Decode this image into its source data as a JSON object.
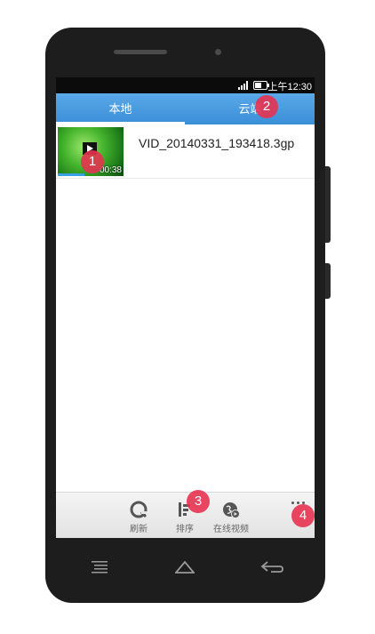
{
  "status_bar": {
    "time": "上午12:30"
  },
  "tabs": [
    {
      "label": "本地",
      "selected": true
    },
    {
      "label": "云端",
      "selected": false
    }
  ],
  "videos": [
    {
      "name": "VID_20140331_193418.3gp",
      "duration": "00:38"
    }
  ],
  "bottom_toolbar": {
    "refresh_label": "刷新",
    "sort_label": "排序",
    "online_label": "在线视频",
    "more_icon": "more-dots-icon"
  },
  "badges": [
    "1",
    "2",
    "3",
    "4"
  ],
  "nav_bar": {
    "menu_icon": "menu-icon",
    "home_icon": "home-icon",
    "back_icon": "back-icon"
  },
  "colors": {
    "tab_bar": "#4a9de2",
    "badge": "#e63250",
    "phone_body": "#1d1d1d"
  }
}
